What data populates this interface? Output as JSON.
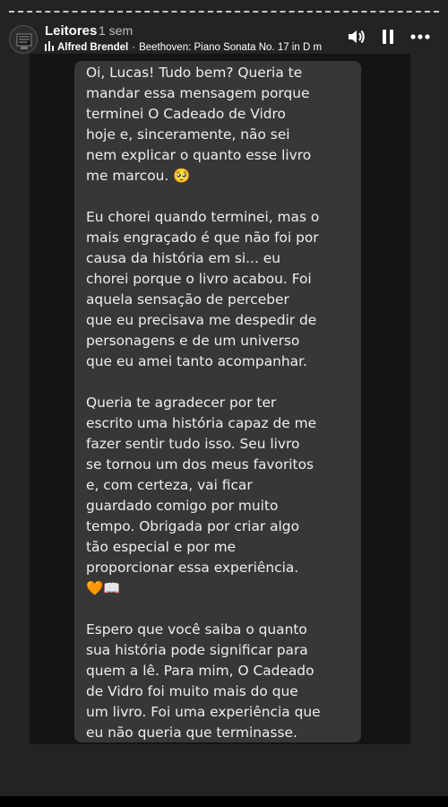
{
  "story": {
    "username": "Leitores",
    "time_ago": "1 sem",
    "music": {
      "artist": "Alfred Brendel",
      "separator": "·",
      "track": "Beethoven: Piano Sonata No. 17 in D m"
    },
    "controls": [
      "volume-icon",
      "pause-icon",
      "more-options-icon"
    ]
  },
  "message": {
    "paragraph_1": [
      "Oi, Lucas! Tudo bem? Queria te",
      "mandar essa mensagem porque",
      "terminei O Cadeado de Vidro",
      "hoje e, sinceramente, não sei",
      "nem explicar o quanto esse livro",
      "me marcou. 🥺"
    ],
    "paragraph_2": [
      "Eu chorei quando terminei, mas o",
      "mais engraçado é que não foi por",
      "causa da história em si... eu",
      "chorei porque o livro acabou. Foi",
      "aquela sensação de perceber",
      "que eu precisava me despedir de",
      "personagens e de um universo",
      "que eu amei tanto acompanhar."
    ],
    "paragraph_3": [
      "Queria te agradecer por ter",
      "escrito uma história capaz de me",
      "fazer sentir tudo isso. Seu livro",
      "se tornou um dos meus favoritos",
      "e, com certeza, vai ficar",
      "guardado comigo por muito",
      "tempo. Obrigada por criar algo",
      "tão especial e por me",
      "proporcionar essa experiência.",
      "🧡📖"
    ],
    "paragraph_4": [
      "Espero que você saiba o quanto",
      "sua história pode significar para",
      "quem a lê. Para mim, O Cadeado",
      "de Vidro foi muito mais do que",
      "um livro. Foi uma experiência que",
      "eu não queria que terminasse."
    ]
  },
  "colors": {
    "background": "#232323",
    "card": "#141414",
    "bubble": "#373737",
    "text": "#eeeeee"
  }
}
